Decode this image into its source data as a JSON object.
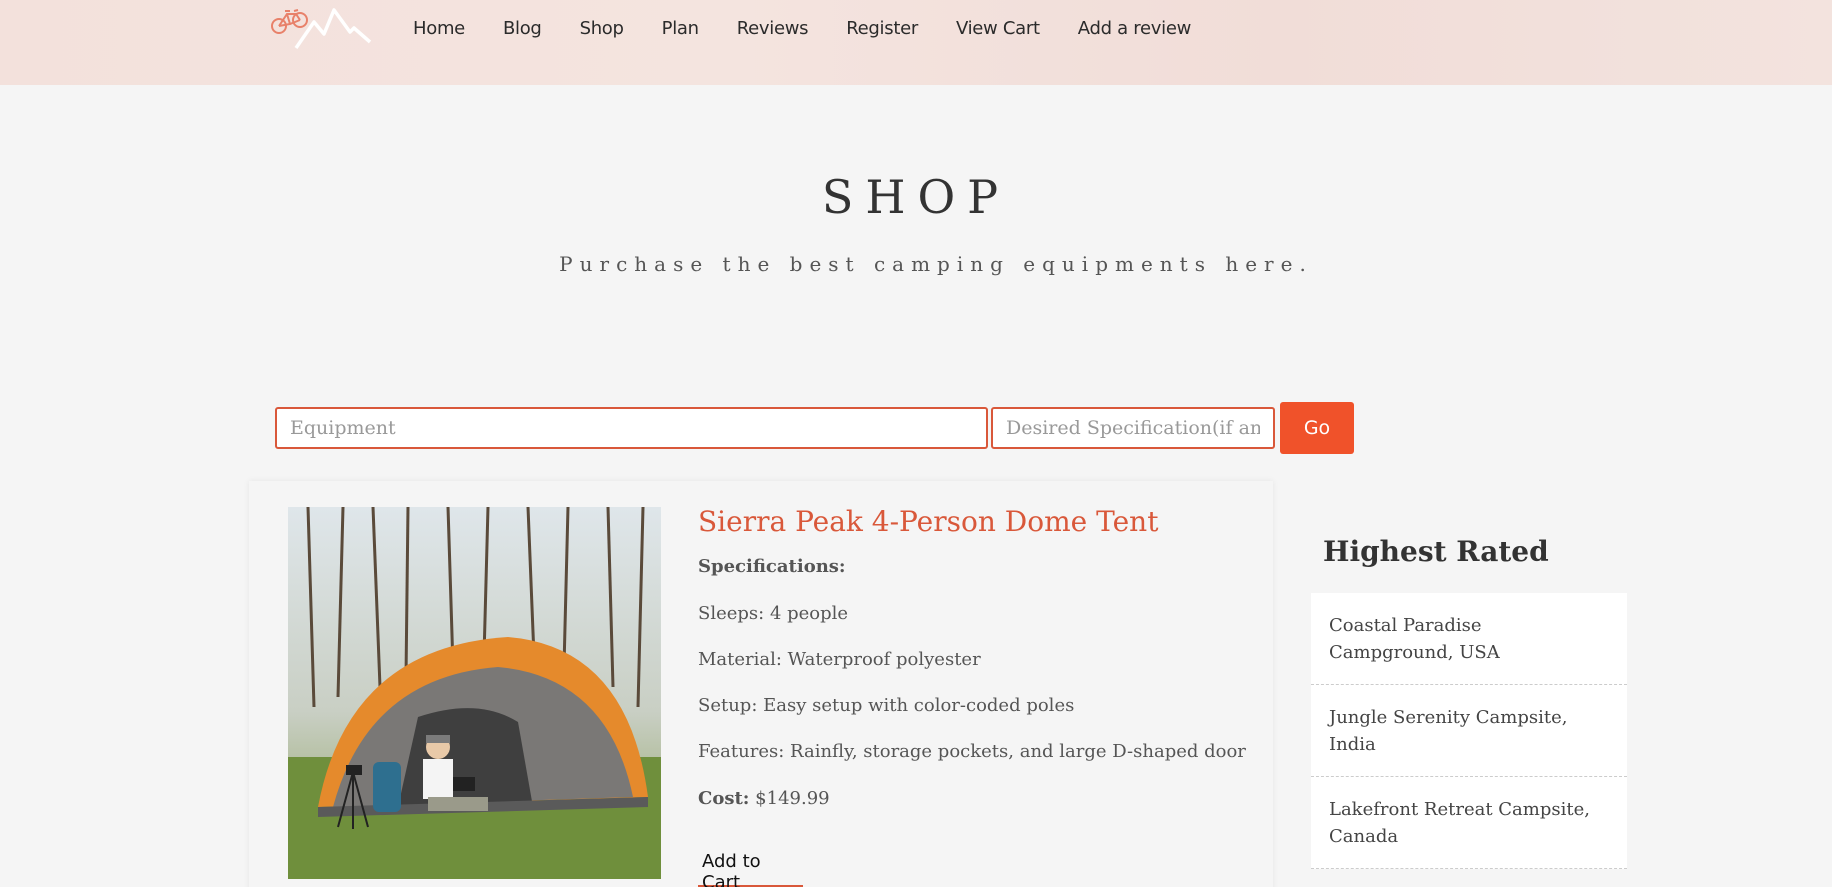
{
  "nav": {
    "items": [
      "Home",
      "Blog",
      "Shop",
      "Plan",
      "Reviews",
      "Register",
      "View Cart",
      "Add a review"
    ]
  },
  "hero": {
    "title": "SHOP",
    "subtitle": "Purchase the best camping equipments here."
  },
  "search": {
    "equipment_placeholder": "Equipment",
    "spec_placeholder": "Desired Specification(if any)",
    "go_label": "Go"
  },
  "product": {
    "name": "Sierra Peak 4-Person Dome Tent",
    "spec_heading": "Specifications:",
    "sleeps": "Sleeps: 4 people",
    "material": "Material: Waterproof polyester",
    "setup": "Setup: Easy setup with color-coded poles",
    "features": "Features: Rainfly, storage pockets, and large D-shaped door",
    "cost_label": "Cost:",
    "cost_value": "$149.99",
    "add_to_cart": "Add to Cart"
  },
  "sidebar": {
    "title": "Highest Rated",
    "items": [
      "Coastal Paradise Campground, USA",
      "Jungle Serenity Campsite, India",
      "Lakefront Retreat Campsite, Canada"
    ]
  },
  "colors": {
    "accent": "#f0522a",
    "title_accent": "#d9583a"
  }
}
